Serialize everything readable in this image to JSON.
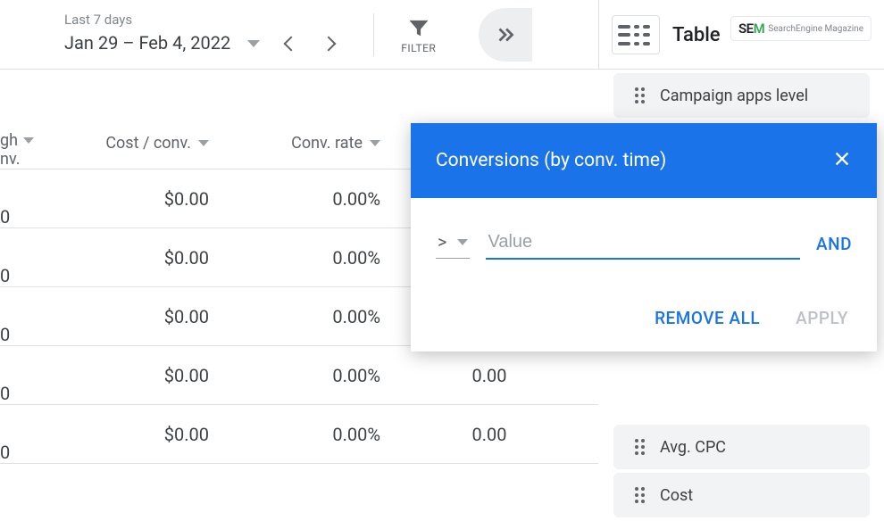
{
  "date_picker": {
    "preset_label": "Last 7 days",
    "range_text": "Jan 29 – Feb 4, 2022"
  },
  "toolbar": {
    "filter_label": "FILTER"
  },
  "panel": {
    "title": "Table"
  },
  "watermark": {
    "prefix": "SE",
    "accent": "M",
    "sub": "SearchEngine Magazine"
  },
  "columns": {
    "through_conv": {
      "line1_frag": "gh",
      "line2": "nv."
    },
    "cost_per_conv": "Cost / conv.",
    "conv_rate": "Conv. rate"
  },
  "rows": [
    {
      "c1": "0",
      "c2": "$0.00",
      "c3": "0.00%",
      "c4": ""
    },
    {
      "c1": "0",
      "c2": "$0.00",
      "c3": "0.00%",
      "c4": ""
    },
    {
      "c1": "0",
      "c2": "$0.00",
      "c3": "0.00%",
      "c4": ""
    },
    {
      "c1": "0",
      "c2": "$0.00",
      "c3": "0.00%",
      "c4": "0.00"
    },
    {
      "c1": "0",
      "c2": "$0.00",
      "c3": "0.00%",
      "c4": "0.00"
    }
  ],
  "metric_items": {
    "campaign_apps": "Campaign apps level",
    "avg_cpc": "Avg. CPC",
    "cost": "Cost"
  },
  "filter_dialog": {
    "title": "Conversions (by conv. time)",
    "operator": ">",
    "value_placeholder": "Value",
    "and_label": "AND",
    "remove_all": "REMOVE ALL",
    "apply": "APPLY"
  }
}
